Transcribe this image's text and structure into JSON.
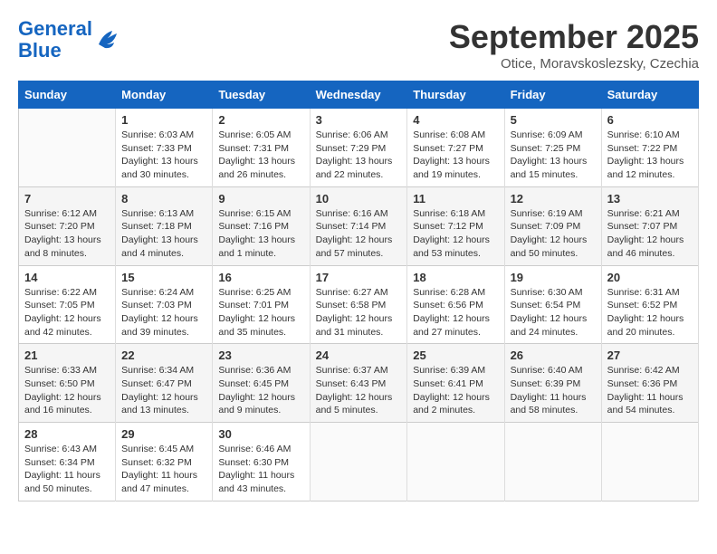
{
  "header": {
    "logo_general": "General",
    "logo_blue": "Blue",
    "month_title": "September 2025",
    "subtitle": "Otice, Moravskoslezsky, Czechia"
  },
  "days_of_week": [
    "Sunday",
    "Monday",
    "Tuesday",
    "Wednesday",
    "Thursday",
    "Friday",
    "Saturday"
  ],
  "weeks": [
    [
      {
        "day": "",
        "sunrise": "",
        "sunset": "",
        "daylight": ""
      },
      {
        "day": "1",
        "sunrise": "Sunrise: 6:03 AM",
        "sunset": "Sunset: 7:33 PM",
        "daylight": "Daylight: 13 hours and 30 minutes."
      },
      {
        "day": "2",
        "sunrise": "Sunrise: 6:05 AM",
        "sunset": "Sunset: 7:31 PM",
        "daylight": "Daylight: 13 hours and 26 minutes."
      },
      {
        "day": "3",
        "sunrise": "Sunrise: 6:06 AM",
        "sunset": "Sunset: 7:29 PM",
        "daylight": "Daylight: 13 hours and 22 minutes."
      },
      {
        "day": "4",
        "sunrise": "Sunrise: 6:08 AM",
        "sunset": "Sunset: 7:27 PM",
        "daylight": "Daylight: 13 hours and 19 minutes."
      },
      {
        "day": "5",
        "sunrise": "Sunrise: 6:09 AM",
        "sunset": "Sunset: 7:25 PM",
        "daylight": "Daylight: 13 hours and 15 minutes."
      },
      {
        "day": "6",
        "sunrise": "Sunrise: 6:10 AM",
        "sunset": "Sunset: 7:22 PM",
        "daylight": "Daylight: 13 hours and 12 minutes."
      }
    ],
    [
      {
        "day": "7",
        "sunrise": "Sunrise: 6:12 AM",
        "sunset": "Sunset: 7:20 PM",
        "daylight": "Daylight: 13 hours and 8 minutes."
      },
      {
        "day": "8",
        "sunrise": "Sunrise: 6:13 AM",
        "sunset": "Sunset: 7:18 PM",
        "daylight": "Daylight: 13 hours and 4 minutes."
      },
      {
        "day": "9",
        "sunrise": "Sunrise: 6:15 AM",
        "sunset": "Sunset: 7:16 PM",
        "daylight": "Daylight: 13 hours and 1 minute."
      },
      {
        "day": "10",
        "sunrise": "Sunrise: 6:16 AM",
        "sunset": "Sunset: 7:14 PM",
        "daylight": "Daylight: 12 hours and 57 minutes."
      },
      {
        "day": "11",
        "sunrise": "Sunrise: 6:18 AM",
        "sunset": "Sunset: 7:12 PM",
        "daylight": "Daylight: 12 hours and 53 minutes."
      },
      {
        "day": "12",
        "sunrise": "Sunrise: 6:19 AM",
        "sunset": "Sunset: 7:09 PM",
        "daylight": "Daylight: 12 hours and 50 minutes."
      },
      {
        "day": "13",
        "sunrise": "Sunrise: 6:21 AM",
        "sunset": "Sunset: 7:07 PM",
        "daylight": "Daylight: 12 hours and 46 minutes."
      }
    ],
    [
      {
        "day": "14",
        "sunrise": "Sunrise: 6:22 AM",
        "sunset": "Sunset: 7:05 PM",
        "daylight": "Daylight: 12 hours and 42 minutes."
      },
      {
        "day": "15",
        "sunrise": "Sunrise: 6:24 AM",
        "sunset": "Sunset: 7:03 PM",
        "daylight": "Daylight: 12 hours and 39 minutes."
      },
      {
        "day": "16",
        "sunrise": "Sunrise: 6:25 AM",
        "sunset": "Sunset: 7:01 PM",
        "daylight": "Daylight: 12 hours and 35 minutes."
      },
      {
        "day": "17",
        "sunrise": "Sunrise: 6:27 AM",
        "sunset": "Sunset: 6:58 PM",
        "daylight": "Daylight: 12 hours and 31 minutes."
      },
      {
        "day": "18",
        "sunrise": "Sunrise: 6:28 AM",
        "sunset": "Sunset: 6:56 PM",
        "daylight": "Daylight: 12 hours and 27 minutes."
      },
      {
        "day": "19",
        "sunrise": "Sunrise: 6:30 AM",
        "sunset": "Sunset: 6:54 PM",
        "daylight": "Daylight: 12 hours and 24 minutes."
      },
      {
        "day": "20",
        "sunrise": "Sunrise: 6:31 AM",
        "sunset": "Sunset: 6:52 PM",
        "daylight": "Daylight: 12 hours and 20 minutes."
      }
    ],
    [
      {
        "day": "21",
        "sunrise": "Sunrise: 6:33 AM",
        "sunset": "Sunset: 6:50 PM",
        "daylight": "Daylight: 12 hours and 16 minutes."
      },
      {
        "day": "22",
        "sunrise": "Sunrise: 6:34 AM",
        "sunset": "Sunset: 6:47 PM",
        "daylight": "Daylight: 12 hours and 13 minutes."
      },
      {
        "day": "23",
        "sunrise": "Sunrise: 6:36 AM",
        "sunset": "Sunset: 6:45 PM",
        "daylight": "Daylight: 12 hours and 9 minutes."
      },
      {
        "day": "24",
        "sunrise": "Sunrise: 6:37 AM",
        "sunset": "Sunset: 6:43 PM",
        "daylight": "Daylight: 12 hours and 5 minutes."
      },
      {
        "day": "25",
        "sunrise": "Sunrise: 6:39 AM",
        "sunset": "Sunset: 6:41 PM",
        "daylight": "Daylight: 12 hours and 2 minutes."
      },
      {
        "day": "26",
        "sunrise": "Sunrise: 6:40 AM",
        "sunset": "Sunset: 6:39 PM",
        "daylight": "Daylight: 11 hours and 58 minutes."
      },
      {
        "day": "27",
        "sunrise": "Sunrise: 6:42 AM",
        "sunset": "Sunset: 6:36 PM",
        "daylight": "Daylight: 11 hours and 54 minutes."
      }
    ],
    [
      {
        "day": "28",
        "sunrise": "Sunrise: 6:43 AM",
        "sunset": "Sunset: 6:34 PM",
        "daylight": "Daylight: 11 hours and 50 minutes."
      },
      {
        "day": "29",
        "sunrise": "Sunrise: 6:45 AM",
        "sunset": "Sunset: 6:32 PM",
        "daylight": "Daylight: 11 hours and 47 minutes."
      },
      {
        "day": "30",
        "sunrise": "Sunrise: 6:46 AM",
        "sunset": "Sunset: 6:30 PM",
        "daylight": "Daylight: 11 hours and 43 minutes."
      },
      {
        "day": "",
        "sunrise": "",
        "sunset": "",
        "daylight": ""
      },
      {
        "day": "",
        "sunrise": "",
        "sunset": "",
        "daylight": ""
      },
      {
        "day": "",
        "sunrise": "",
        "sunset": "",
        "daylight": ""
      },
      {
        "day": "",
        "sunrise": "",
        "sunset": "",
        "daylight": ""
      }
    ]
  ]
}
